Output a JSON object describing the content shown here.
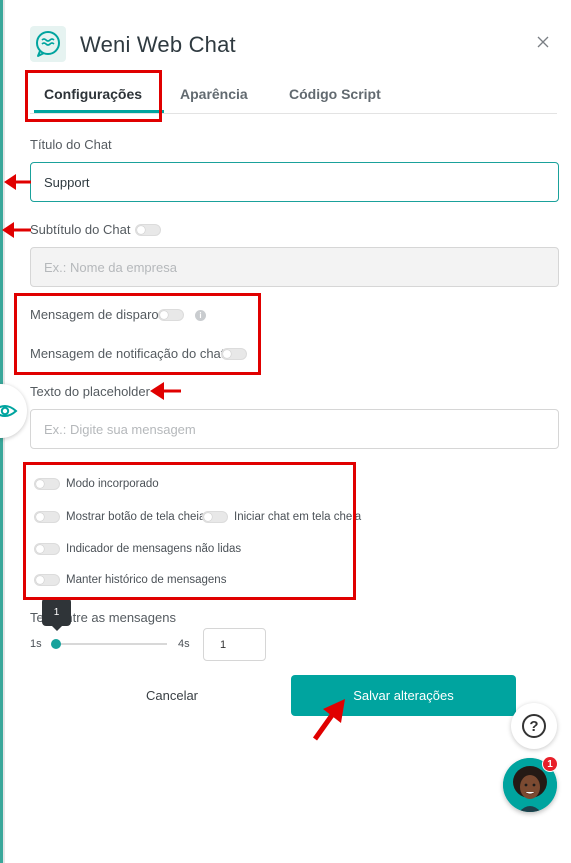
{
  "header": {
    "title": "Weni Web Chat",
    "logo_icon": "weni-chat-logo-icon",
    "close_icon": "close-icon"
  },
  "tabs": [
    {
      "label": "Configurações",
      "active": true
    },
    {
      "label": "Aparência",
      "active": false
    },
    {
      "label": "Código Script",
      "active": false
    }
  ],
  "form": {
    "chat_title_label": "Título do Chat",
    "chat_title_value": "Support",
    "chat_subtitle_label": "Subtítulo do Chat",
    "chat_subtitle_placeholder": "Ex.: Nome da empresa",
    "trigger_message_label": "Mensagem de disparo",
    "notification_message_label": "Mensagem de notificação do chat",
    "placeholder_text_label": "Texto do placeholder",
    "placeholder_text_placeholder": "Ex.: Digite sua mensagem",
    "toggles": {
      "embedded_mode": "Modo incorporado",
      "fullscreen_button": "Mostrar botão de tela cheia",
      "start_fullscreen": "Iniciar chat em tela cheia",
      "unread_indicator": "Indicador de mensagens não lidas",
      "keep_history": "Manter histórico de mensagens"
    },
    "interval_label": "Tempo entre as mensagens",
    "interval_label_visible": "Te    entre as mensagens",
    "slider_min": "1s",
    "slider_max": "4s",
    "slider_value": "1",
    "interval_value": "1",
    "slider_fraction": 0.0
  },
  "actions": {
    "cancel": "Cancelar",
    "save": "Salvar alterações"
  },
  "floating": {
    "help_icon": "question-icon",
    "chat_badge": "1"
  },
  "colors": {
    "accent": "#00a49f",
    "annotation": "#e00000",
    "text": "#333333"
  }
}
